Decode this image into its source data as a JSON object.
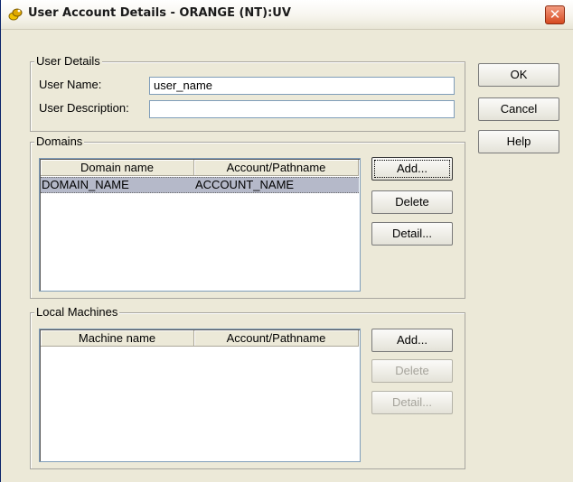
{
  "window": {
    "title": "User Account Details - ORANGE (NT):UV",
    "close_glyph": "✕"
  },
  "user_details": {
    "group_label": "User Details",
    "user_name_label": "User Name:",
    "user_name_value": "user_name",
    "user_description_label": "User Description:",
    "user_description_value": ""
  },
  "domains": {
    "group_label": "Domains",
    "columns": [
      "Domain name",
      "Account/Pathname"
    ],
    "rows": [
      {
        "domain": "DOMAIN_NAME",
        "account": "ACCOUNT_NAME",
        "selected": true
      }
    ],
    "buttons": {
      "add": "Add...",
      "delete": "Delete",
      "detail": "Detail..."
    }
  },
  "local_machines": {
    "group_label": "Local Machines",
    "columns": [
      "Machine name",
      "Account/Pathname"
    ],
    "rows": [],
    "buttons": {
      "add": "Add...",
      "delete": "Delete",
      "detail": "Detail..."
    }
  },
  "dialog_buttons": {
    "ok": "OK",
    "cancel": "Cancel",
    "help": "Help"
  },
  "colors": {
    "selection": "#b5b9c9",
    "close_button": "#d64a21",
    "dialog_bg": "#ece9d8"
  }
}
